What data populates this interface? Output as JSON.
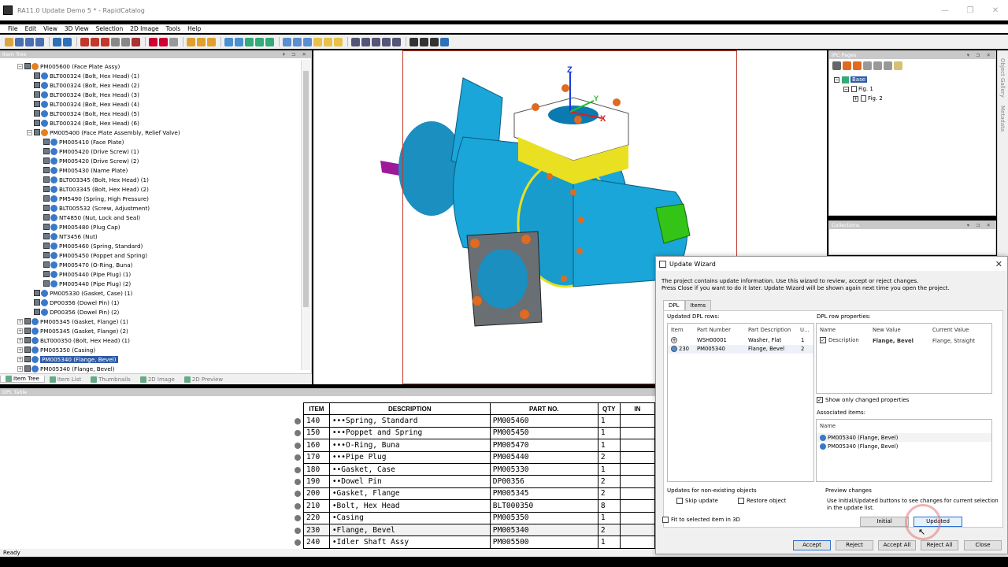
{
  "window": {
    "title": "RA11.0 Update Demo 5 * - RapidCatalog",
    "controls": [
      "—",
      "❐",
      "✕"
    ]
  },
  "menu": [
    "File",
    "Edit",
    "View",
    "3D View",
    "Selection",
    "2D Image",
    "Tools",
    "Help"
  ],
  "item_tree": {
    "header": "Item Tree",
    "header_controls": "▾ ⊐ ✕",
    "nodes": [
      {
        "label": "PM005600 (Face Plate Assy)",
        "level": 0,
        "exp": "−",
        "org": true
      },
      {
        "label": "BLT000324 (Bolt, Hex Head) (1)",
        "level": 1
      },
      {
        "label": "BLT000324 (Bolt, Hex Head) (2)",
        "level": 1
      },
      {
        "label": "BLT000324 (Bolt, Hex Head) (3)",
        "level": 1
      },
      {
        "label": "BLT000324 (Bolt, Hex Head) (4)",
        "level": 1
      },
      {
        "label": "BLT000324 (Bolt, Hex Head) (5)",
        "level": 1
      },
      {
        "label": "BLT000324 (Bolt, Hex Head) (6)",
        "level": 1
      },
      {
        "label": "PM005400 (Face Plate Assembly, Relief Valve)",
        "level": 1,
        "exp": "−",
        "org": true
      },
      {
        "label": "PM005410 (Face Plate)",
        "level": 2
      },
      {
        "label": "PM005420 (Drive Screw) (1)",
        "level": 2
      },
      {
        "label": "PM005420 (Drive Screw) (2)",
        "level": 2
      },
      {
        "label": "PM005430 (Name Plate)",
        "level": 2
      },
      {
        "label": "BLT003345 (Bolt, Hex Head) (1)",
        "level": 2
      },
      {
        "label": "BLT003345 (Bolt, Hex Head) (2)",
        "level": 2
      },
      {
        "label": "PM5490 (Spring, High Pressure)",
        "level": 2
      },
      {
        "label": "BLT005532 (Screw, Adjustment)",
        "level": 2
      },
      {
        "label": "NT4850 (Nut, Lock and Seal)",
        "level": 2
      },
      {
        "label": "PM005480 (Plug Cap)",
        "level": 2
      },
      {
        "label": "NT3456 (Nut)",
        "level": 2
      },
      {
        "label": "PM005460 (Spring, Standard)",
        "level": 2
      },
      {
        "label": "PM005450 (Poppet and Spring)",
        "level": 2
      },
      {
        "label": "PM005470 (O-Ring, Buna)",
        "level": 2
      },
      {
        "label": "PM005440 (Pipe Plug) (1)",
        "level": 2
      },
      {
        "label": "PM005440 (Pipe Plug) (2)",
        "level": 2
      },
      {
        "label": "PM005330 (Gasket, Case) (1)",
        "level": 1
      },
      {
        "label": "DP00356 (Dowel Pin) (1)",
        "level": 1
      },
      {
        "label": "DP00356 (Dowel Pin) (2)",
        "level": 1
      },
      {
        "label": "PM005345 (Gasket, Flange) (1)",
        "level": 0,
        "exp": "+"
      },
      {
        "label": "PM005345 (Gasket, Flange) (2)",
        "level": 0,
        "exp": "+"
      },
      {
        "label": "BLT000350 (Bolt, Hex Head) (1)",
        "level": 0,
        "exp": "+"
      },
      {
        "label": "PM005350 (Casing)",
        "level": 0,
        "exp": "+"
      },
      {
        "label": "PM005340 (Flange, Bevel)",
        "level": 0,
        "exp": "+",
        "selected": true
      },
      {
        "label": "PM005340 (Flange, Bevel)",
        "level": 0,
        "exp": "+"
      }
    ],
    "tabs": [
      "Item Tree",
      "Item List",
      "Thumbnails",
      "2D Image",
      "2D Preview"
    ]
  },
  "viewport": {
    "axis_z": "Z",
    "axis_x": "X",
    "axis_y": "Y"
  },
  "ipc_pages": {
    "header": "IPC Pages",
    "root": "Base",
    "fig1": "Fig. 1",
    "fig2": "Fig. 2"
  },
  "collections": {
    "header": "Collections"
  },
  "right_tabs": [
    "Object Gallery",
    "Metadata"
  ],
  "dpl_table": {
    "header": "DPL Table",
    "columns": [
      "ITEM",
      "DESCRIPTION",
      "PART NO.",
      "QTY",
      "IN"
    ],
    "rows": [
      {
        "item": "140",
        "desc": "•••Spring, Standard",
        "part": "PM005460",
        "qty": "1"
      },
      {
        "item": "150",
        "desc": "•••Poppet and Spring",
        "part": "PM005450",
        "qty": "1"
      },
      {
        "item": "160",
        "desc": "•••O-Ring, Buna",
        "part": "PM005470",
        "qty": "1"
      },
      {
        "item": "170",
        "desc": "•••Pipe Plug",
        "part": "PM005440",
        "qty": "2"
      },
      {
        "item": "180",
        "desc": "••Gasket, Case",
        "part": "PM005330",
        "qty": "1"
      },
      {
        "item": "190",
        "desc": "••Dowel Pin",
        "part": "DP00356",
        "qty": "2"
      },
      {
        "item": "200",
        "desc": "•Gasket, Flange",
        "part": "PM005345",
        "qty": "2"
      },
      {
        "item": "210",
        "desc": "•Bolt, Hex Head",
        "part": "BLT000350",
        "qty": "8"
      },
      {
        "item": "220",
        "desc": "•Casing",
        "part": "PM005350",
        "qty": "1"
      },
      {
        "item": "230",
        "desc": "•Flange, Bevel",
        "part": "PM005340",
        "qty": "2",
        "highlight": true
      },
      {
        "item": "240",
        "desc": "•Idler Shaft Assy",
        "part": "PM005500",
        "qty": "1"
      }
    ]
  },
  "status": "Ready",
  "wizard": {
    "title": "Update Wizard",
    "intro1": "The project contains update information. Use this wizard to review, accept or reject changes.",
    "intro2": "Press Close if you want to do it later. Update Wizard will be shown again next time you open the project.",
    "tabs": [
      "DPL",
      "Items"
    ],
    "updated_rows_label": "Updated DPL rows:",
    "rows_cols": [
      "Item",
      "Part Number",
      "Part Description",
      "U..."
    ],
    "rows": [
      {
        "item": "",
        "part": "WSH00001",
        "desc": "Washer, Flat",
        "u": "1",
        "icon": "plus"
      },
      {
        "item": "230",
        "part": "PM005340",
        "desc": "Flange, Bevel",
        "u": "2",
        "icon": "edit"
      }
    ],
    "props_label": "DPL row properties:",
    "props_cols": [
      "Name",
      "New Value",
      "Current Value"
    ],
    "props": [
      {
        "name": "Description",
        "new": "Flange, Bevel",
        "current": "Flange, Straight"
      }
    ],
    "show_changed": "Show only changed properties",
    "assoc_label": "Associated items:",
    "assoc_col": "Name",
    "assoc": [
      "PM005340 (Flange, Bevel)",
      "PM005340 (Flange, Bevel)"
    ],
    "nonexist_label": "Updates for non-existing objects",
    "skip": "Skip update",
    "restore": "Restore object",
    "fit": "Fit to selected item in 3D",
    "preview_label": "Preview changes",
    "preview_text": "Use Initial/Updated buttons to see changes for current selection in the update list.",
    "btn_initial": "Initial",
    "btn_updated": "Updated",
    "btn_accept": "Accept",
    "btn_reject": "Reject",
    "btn_accept_all": "Accept All",
    "btn_reject_all": "Reject All",
    "btn_close": "Close"
  },
  "colors": {
    "pump_blue": "#1aa6d8",
    "accent": "#2f5ca8",
    "flange_frame": "#c0392b"
  }
}
